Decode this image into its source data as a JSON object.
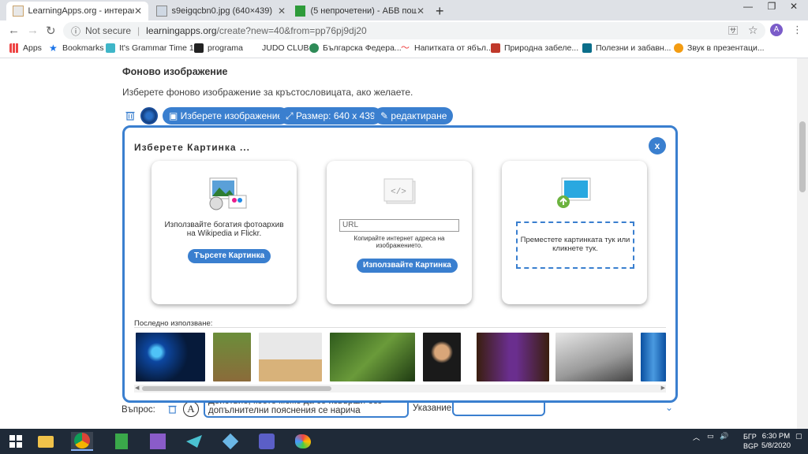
{
  "tabs": [
    {
      "title": "LearningApps.org - интерактив",
      "active": true
    },
    {
      "title": "s9eigqcbn0.jpg (640×439)",
      "active": false
    },
    {
      "title": "(5 непрочетени) - АБВ поща",
      "active": false
    }
  ],
  "window": {
    "minimize": "—",
    "restore": "❐",
    "close": "✕"
  },
  "omnibox": {
    "security": "Not secure",
    "host": "learningapps.org",
    "path": "/create?new=40&from=pp76pj9dj20",
    "avatar": "A"
  },
  "bookmarks": [
    {
      "label": "Apps"
    },
    {
      "label": "Bookmarks"
    },
    {
      "label": "It's Grammar Time 1"
    },
    {
      "label": "programa"
    },
    {
      "label": "JUDO CLUB"
    },
    {
      "label": "Българска Федера..."
    },
    {
      "label": "Напитката от ябъл..."
    },
    {
      "label": "Природна забеле..."
    },
    {
      "label": "Полезни и забавн..."
    },
    {
      "label": "Звук в презентаци..."
    }
  ],
  "page": {
    "section_title": "Фоново изображение",
    "section_desc": "Изберете фоново изображение за кръстословицата, ако желаете.",
    "choose_image": "Изберете изображение",
    "size": "Размер: 640 x 439",
    "edit": "редактиране",
    "question_label": "Въпрос:",
    "question_text": "Действие, което може да се извърши без допълнителни пояснения се нарича",
    "hint_label": "Указание:"
  },
  "modal": {
    "title": "Изберете Картинка ...",
    "close": "x",
    "card1": {
      "desc": "Използвайте богатия фотоархив на Wikipedia и Flickr.",
      "button": "Търсете Картинка"
    },
    "card2": {
      "url_placeholder": "URL",
      "desc": "Копирайте интернет адреса на изображението.",
      "button": "Използвайте Картинка"
    },
    "card3": {
      "drop_text": "Преместете картинката тук или кликнете тук."
    },
    "recent_label": "Последно използване:",
    "recent_images": [
      "virus-blue",
      "deer",
      "camel",
      "jungle",
      "shakespeare",
      "king-throne",
      "tools",
      "battery"
    ]
  },
  "taskbar": {
    "time": "6:30 PM",
    "date": "5/8/2020",
    "lang1": "БГР",
    "lang2": "BGP"
  }
}
